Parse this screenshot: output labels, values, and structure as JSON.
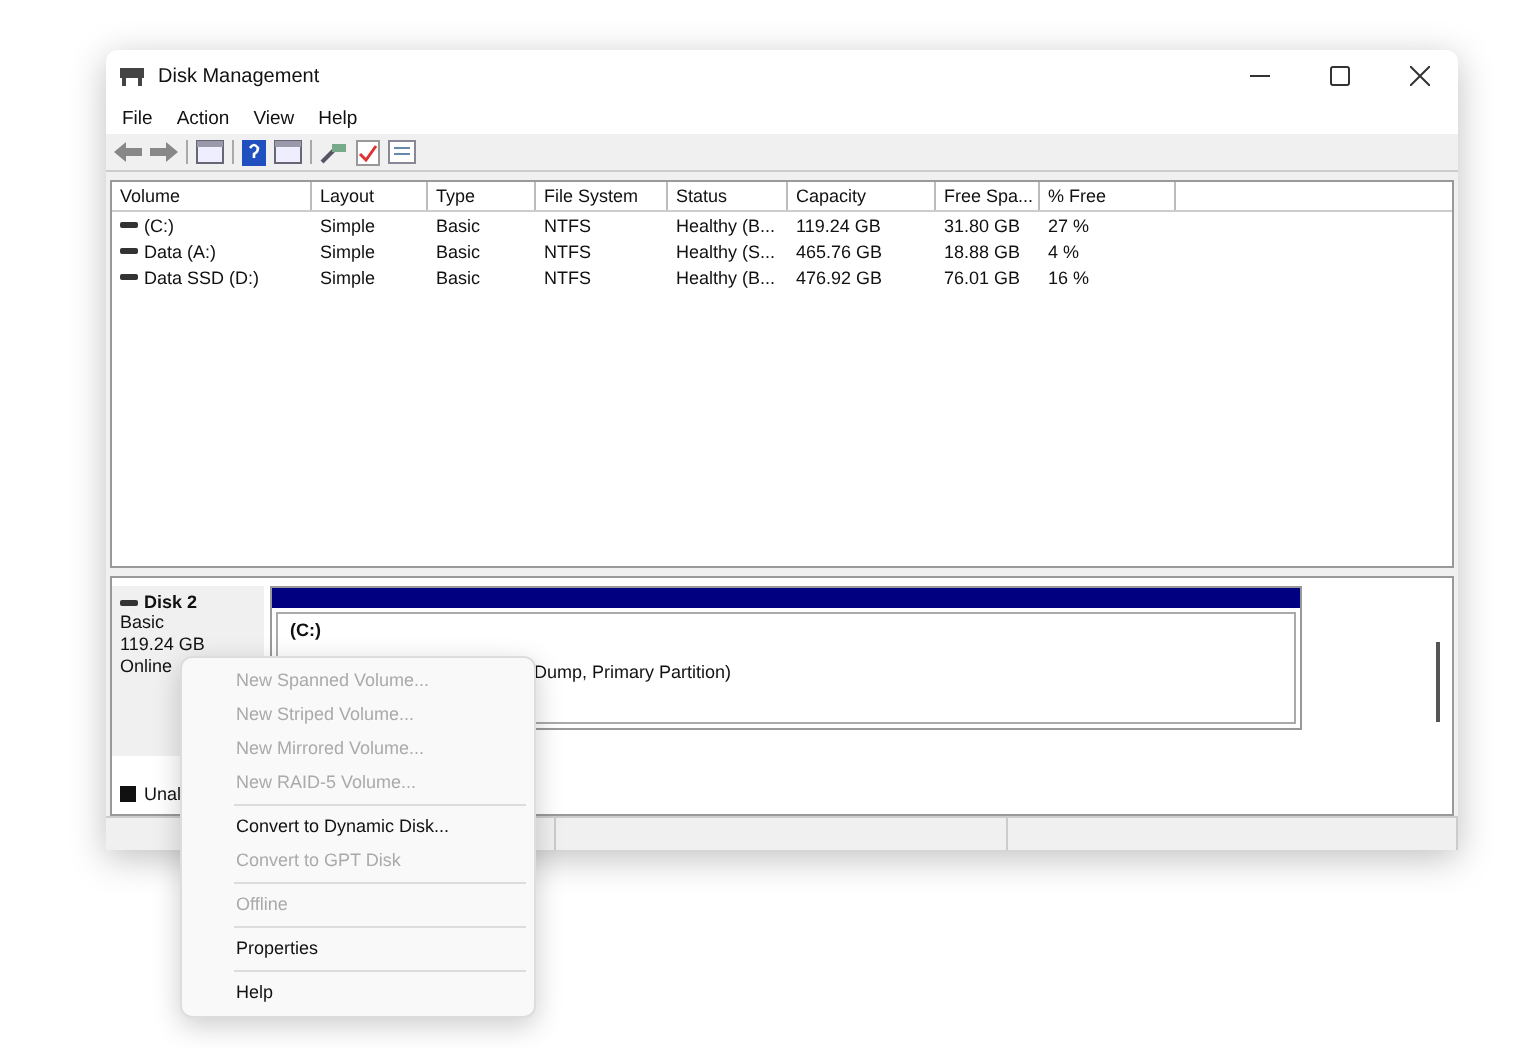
{
  "window": {
    "title": "Disk Management"
  },
  "menu_bar": [
    "File",
    "Action",
    "View",
    "Help"
  ],
  "volume_table": {
    "columns": [
      "Volume",
      "Layout",
      "Type",
      "File System",
      "Status",
      "Capacity",
      "Free Spa...",
      "% Free"
    ],
    "rows": [
      [
        "(C:)",
        "Simple",
        "Basic",
        "NTFS",
        "Healthy (B...",
        "119.24 GB",
        "31.80 GB",
        "27 %"
      ],
      [
        "Data (A:)",
        "Simple",
        "Basic",
        "NTFS",
        "Healthy (S...",
        "465.76 GB",
        "18.88 GB",
        "4 %"
      ],
      [
        "Data SSD (D:)",
        "Simple",
        "Basic",
        "NTFS",
        "Healthy (B...",
        "476.92 GB",
        "76.01 GB",
        "16 %"
      ]
    ]
  },
  "disk": {
    "name": "Disk 2",
    "type": "Basic",
    "size": "119.24 GB",
    "state": "Online",
    "partition": {
      "label": "(C:)",
      "status_tail": "Dump, Primary Partition)"
    },
    "legend": "Unal"
  },
  "context_menu": [
    {
      "kind": "item",
      "label": "New Spanned Volume...",
      "disabled": true
    },
    {
      "kind": "item",
      "label": "New Striped Volume...",
      "disabled": true
    },
    {
      "kind": "item",
      "label": "New Mirrored Volume...",
      "disabled": true
    },
    {
      "kind": "item",
      "label": "New RAID-5 Volume...",
      "disabled": true
    },
    {
      "kind": "separator"
    },
    {
      "kind": "item",
      "label": "Convert to Dynamic Disk...",
      "disabled": false
    },
    {
      "kind": "item",
      "label": "Convert to GPT Disk",
      "disabled": true
    },
    {
      "kind": "separator"
    },
    {
      "kind": "item",
      "label": "Offline",
      "disabled": true
    },
    {
      "kind": "separator"
    },
    {
      "kind": "item",
      "label": "Properties",
      "disabled": false
    },
    {
      "kind": "separator"
    },
    {
      "kind": "item",
      "label": "Help",
      "disabled": false
    }
  ]
}
